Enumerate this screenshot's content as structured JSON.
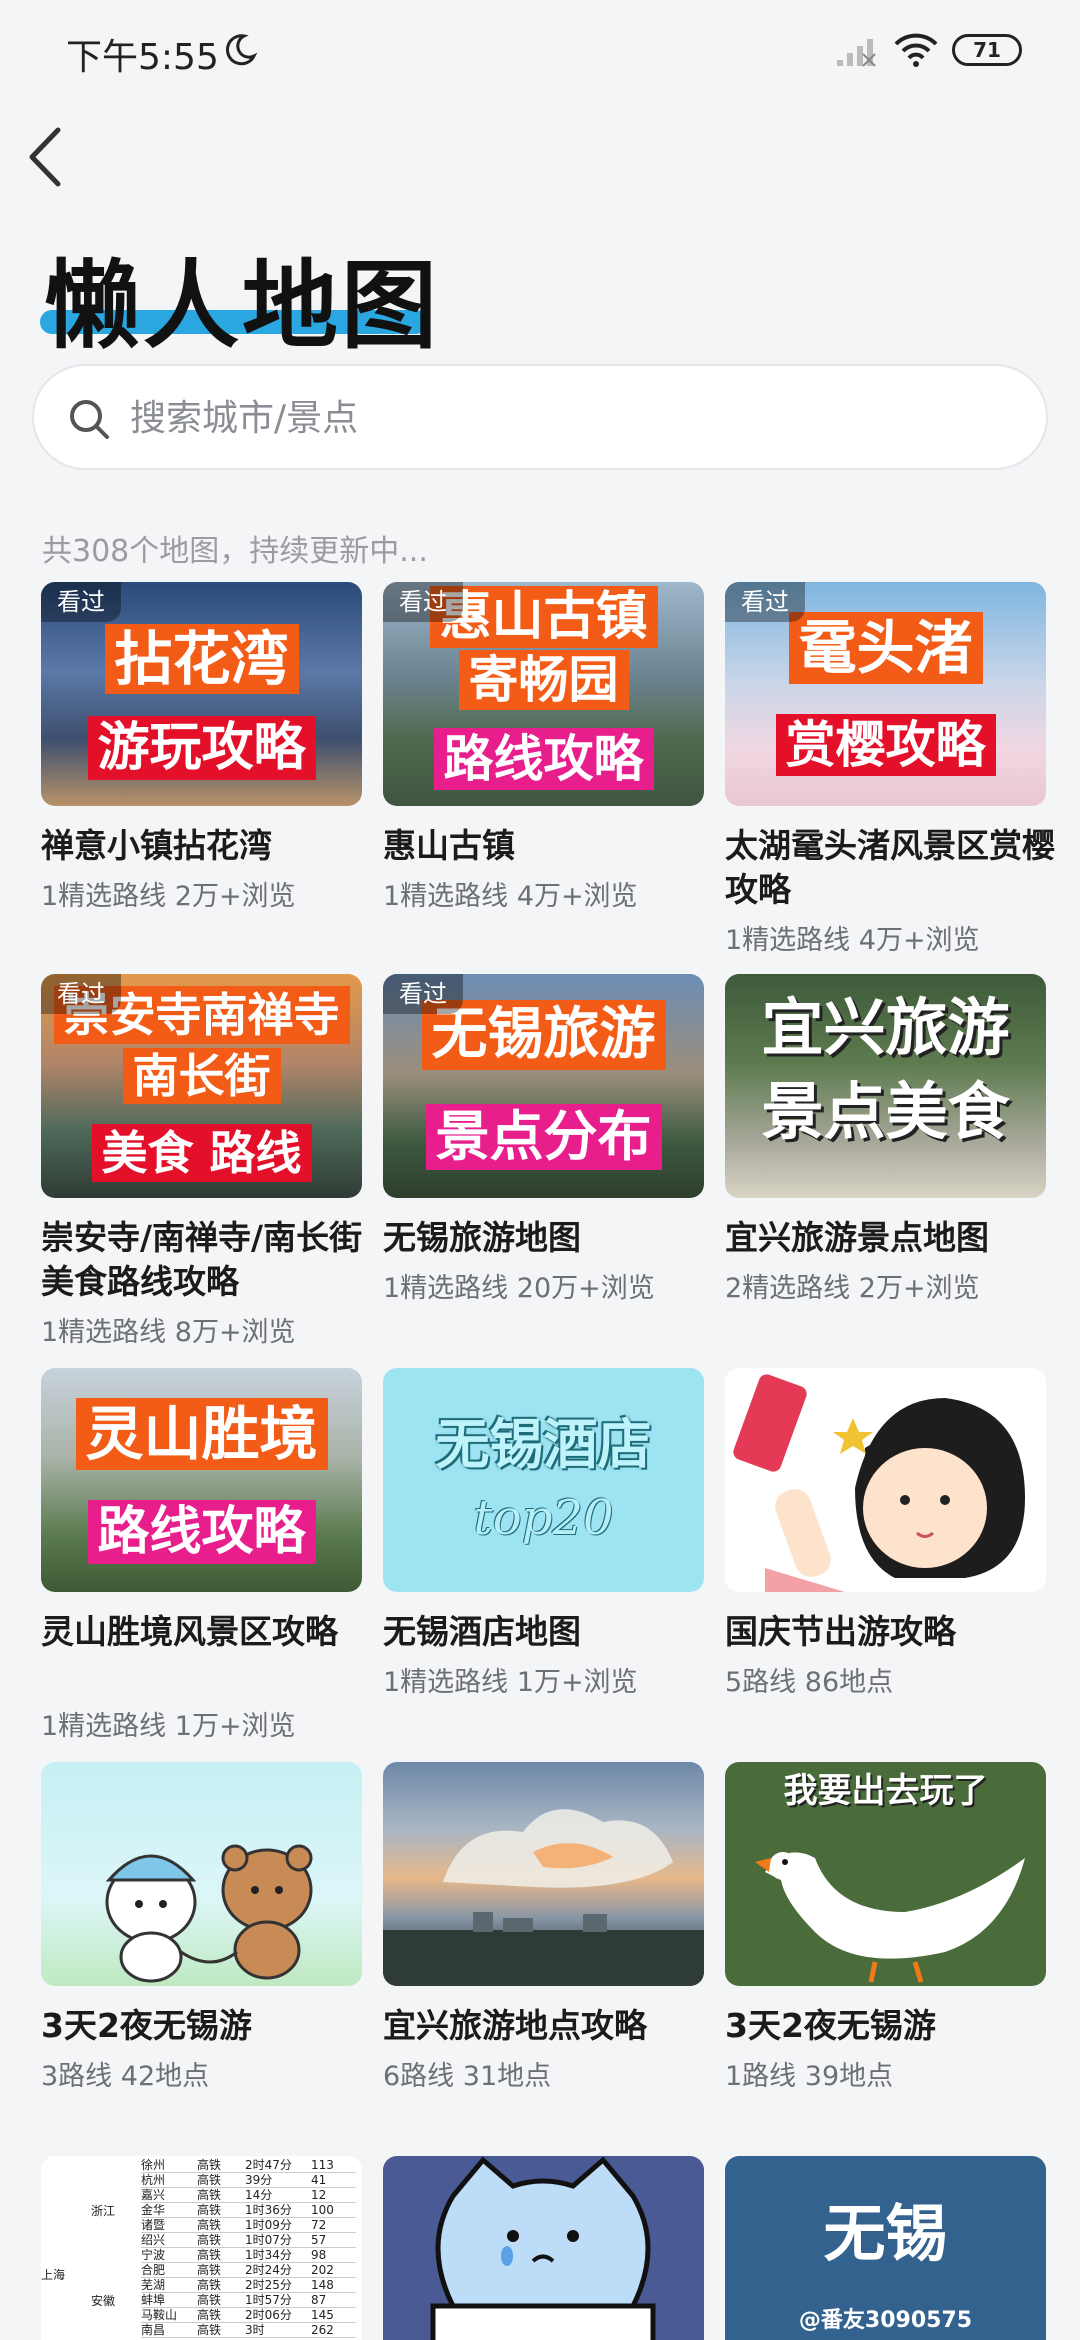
{
  "status": {
    "time": "下午5:55",
    "battery": "71"
  },
  "header": {
    "title": "懒人地图"
  },
  "search": {
    "placeholder": "搜索城市/景点"
  },
  "summary": "共308个地图，持续更新中...",
  "seen_label": "看过",
  "cards": [
    {
      "title": "禅意小镇拈花湾",
      "meta": "1精选路线 2万+浏览",
      "seen": true,
      "banner1": "拈花湾",
      "banner2": "游玩攻略"
    },
    {
      "title": "惠山古镇",
      "meta": "1精选路线 4万+浏览",
      "seen": true,
      "banner1": "惠山古镇",
      "banner1b": "寄畅园",
      "banner2": "路线攻略"
    },
    {
      "title": "太湖鼋头渚风景区赏樱攻略",
      "meta": "1精选路线 4万+浏览",
      "seen": true,
      "banner1": "鼋头渚",
      "banner2": "赏樱攻略"
    },
    {
      "title": "崇安寺/南禅寺/南长街美食路线攻略",
      "meta": "1精选路线 8万+浏览",
      "seen": true,
      "banner1": "崇安寺南禅寺",
      "banner1b": "南长街",
      "banner2": "美食 路线"
    },
    {
      "title": "无锡旅游地图",
      "meta": "1精选路线 20万+浏览",
      "seen": true,
      "banner1": "无锡旅游",
      "banner2": "景点分布"
    },
    {
      "title": "宜兴旅游景点地图",
      "meta": "2精选路线 2万+浏览",
      "seen": false,
      "banner1": "宜兴旅游",
      "banner2": "景点美食"
    },
    {
      "title": "灵山胜境风景区攻略",
      "meta": "1精选路线 1万+浏览",
      "seen": false,
      "banner1": "灵山胜境",
      "banner2": "路线攻略"
    },
    {
      "title": "无锡酒店地图",
      "meta": "1精选路线 1万+浏览",
      "seen": false,
      "banner1": "无锡酒店",
      "banner2": "top20"
    },
    {
      "title": "国庆节出游攻略",
      "meta": "5路线 86地点",
      "seen": false
    },
    {
      "title": "3天2夜无锡游",
      "meta": "3路线 42地点",
      "seen": false
    },
    {
      "title": "宜兴旅游地点攻略",
      "meta": "6路线 31地点",
      "seen": false
    },
    {
      "title": "3天2夜无锡游",
      "meta": "1路线 39地点",
      "seen": false,
      "banner1": "我要出去玩了"
    },
    {
      "title": "",
      "meta": "",
      "seen": false
    },
    {
      "title": "",
      "meta": "",
      "seen": false
    },
    {
      "title": "",
      "meta": "",
      "seen": false,
      "banner1": "无锡",
      "banner2": "@番友3090575"
    }
  ],
  "table_thumb": {
    "left": [
      "浙江",
      "上海",
      "安徽"
    ],
    "rows": [
      [
        "徐州",
        "高铁",
        "2时47分",
        "113"
      ],
      [
        "杭州",
        "高铁",
        "39分",
        "41"
      ],
      [
        "嘉兴",
        "高铁",
        "14分",
        "12"
      ],
      [
        "金华",
        "高铁",
        "1时36分",
        "100"
      ],
      [
        "诸暨",
        "高铁",
        "1时09分",
        "72"
      ],
      [
        "绍兴",
        "高铁",
        "1时07分",
        "57"
      ],
      [
        "宁波",
        "高铁",
        "1时34分",
        "98"
      ],
      [
        "合肥",
        "高铁",
        "2时24分",
        "202"
      ],
      [
        "芜湖",
        "高铁",
        "2时25分",
        "148"
      ],
      [
        "蚌埠",
        "高铁",
        "1时57分",
        "87"
      ],
      [
        "马鞍山",
        "高铁",
        "2时06分",
        "145"
      ],
      [
        "南昌",
        "高铁",
        "3时",
        "262"
      ]
    ]
  }
}
